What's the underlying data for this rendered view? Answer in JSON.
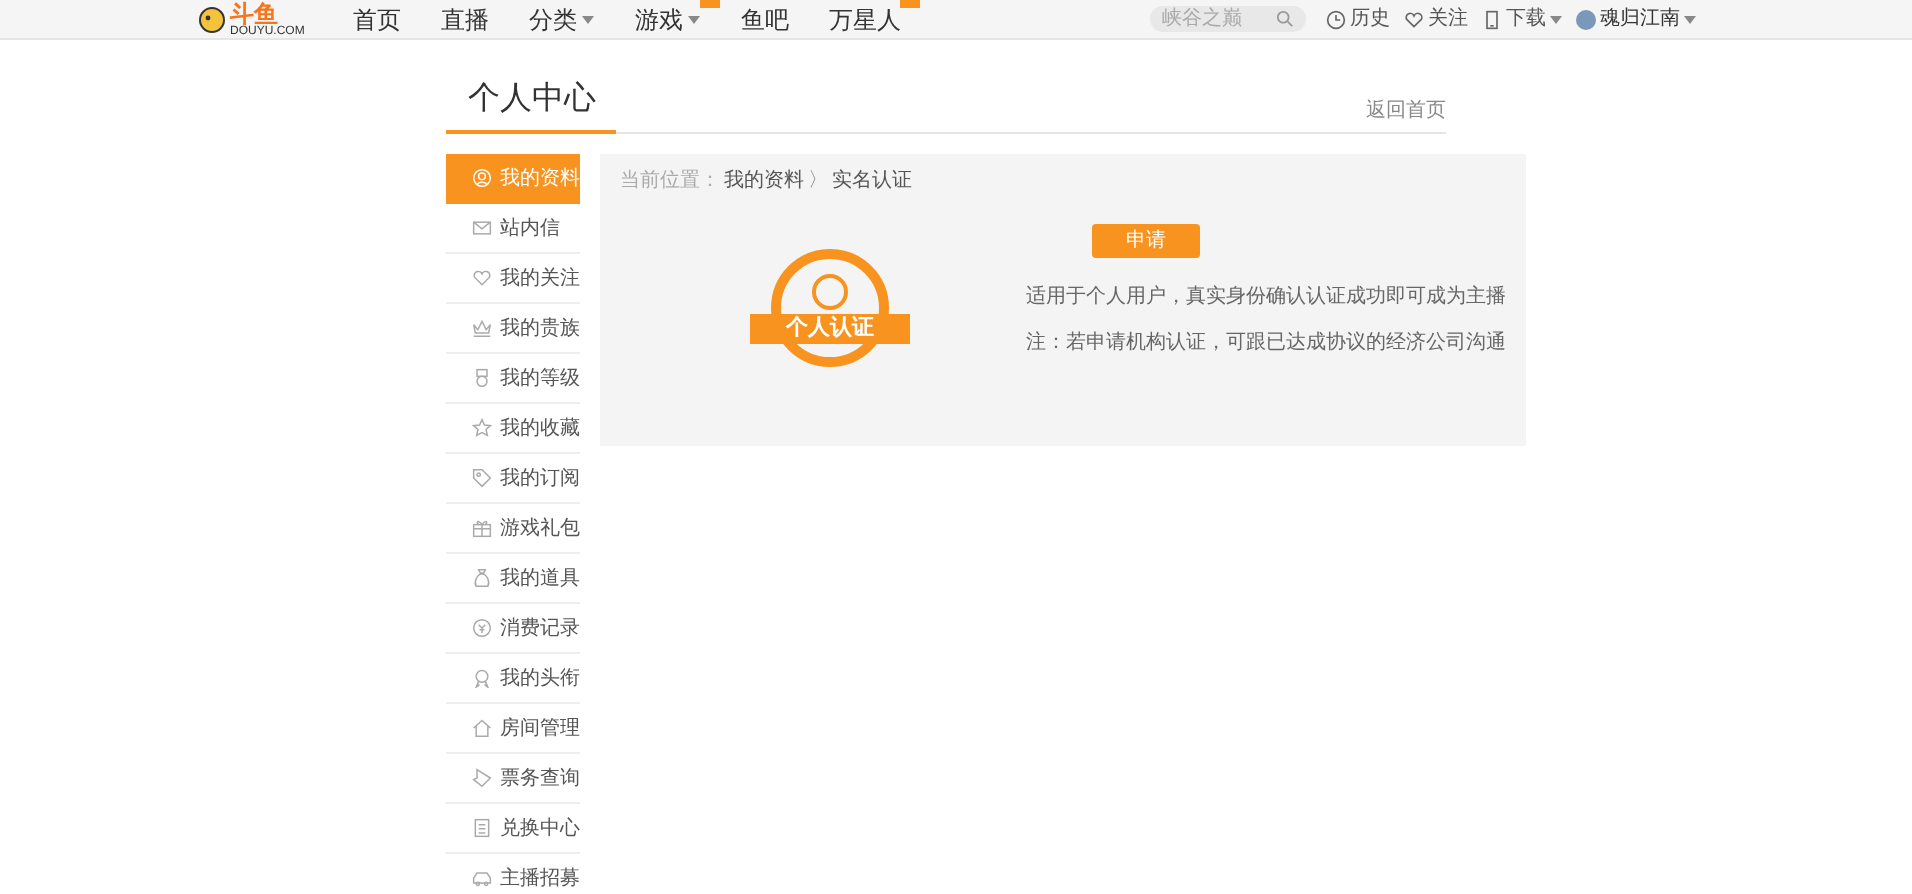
{
  "header": {
    "logo": {
      "name": "斗鱼",
      "domain": "DOUYU.COM"
    },
    "nav": [
      {
        "label": "首页",
        "dropdown": false,
        "badge": false
      },
      {
        "label": "直播",
        "dropdown": false,
        "badge": false
      },
      {
        "label": "分类",
        "dropdown": true,
        "badge": false
      },
      {
        "label": "游戏",
        "dropdown": true,
        "badge": true
      },
      {
        "label": "鱼吧",
        "dropdown": false,
        "badge": false
      },
      {
        "label": "万星人",
        "dropdown": false,
        "badge": true
      }
    ],
    "search": {
      "placeholder": "峡谷之巅"
    },
    "actions": [
      {
        "kind": "history",
        "label": "历史"
      },
      {
        "kind": "follow",
        "label": "关注"
      },
      {
        "kind": "download",
        "label": "下载"
      }
    ],
    "user": {
      "name": "魂归江南"
    }
  },
  "page_title": "个人中心",
  "back_link": "返回首页",
  "sidebar": {
    "items": [
      {
        "label": "我的资料",
        "selected": true
      },
      {
        "label": "站内信",
        "selected": false
      },
      {
        "label": "我的关注",
        "selected": false
      },
      {
        "label": "我的贵族",
        "selected": false
      },
      {
        "label": "我的等级",
        "selected": false
      },
      {
        "label": "我的收藏",
        "selected": false
      },
      {
        "label": "我的订阅",
        "selected": false
      },
      {
        "label": "游戏礼包",
        "selected": false
      },
      {
        "label": "我的道具",
        "selected": false
      },
      {
        "label": "消费记录",
        "selected": false
      },
      {
        "label": "我的头衔",
        "selected": false
      },
      {
        "label": "房间管理",
        "selected": false
      },
      {
        "label": "票务查询",
        "selected": false
      },
      {
        "label": "兑换中心",
        "selected": false
      },
      {
        "label": "主播招募",
        "selected": false
      }
    ]
  },
  "breadcrumb": {
    "prefix": "当前位置：",
    "items": [
      "我的资料",
      "实名认证"
    ],
    "separator": "〉"
  },
  "verification": {
    "badge_label": "个人认证",
    "button": "申请",
    "notes": [
      "适用于个人用户，真实身份确认认证成功即可成为主播",
      "注：若申请机构认证，可跟已达成协议的经济公司沟通"
    ]
  }
}
